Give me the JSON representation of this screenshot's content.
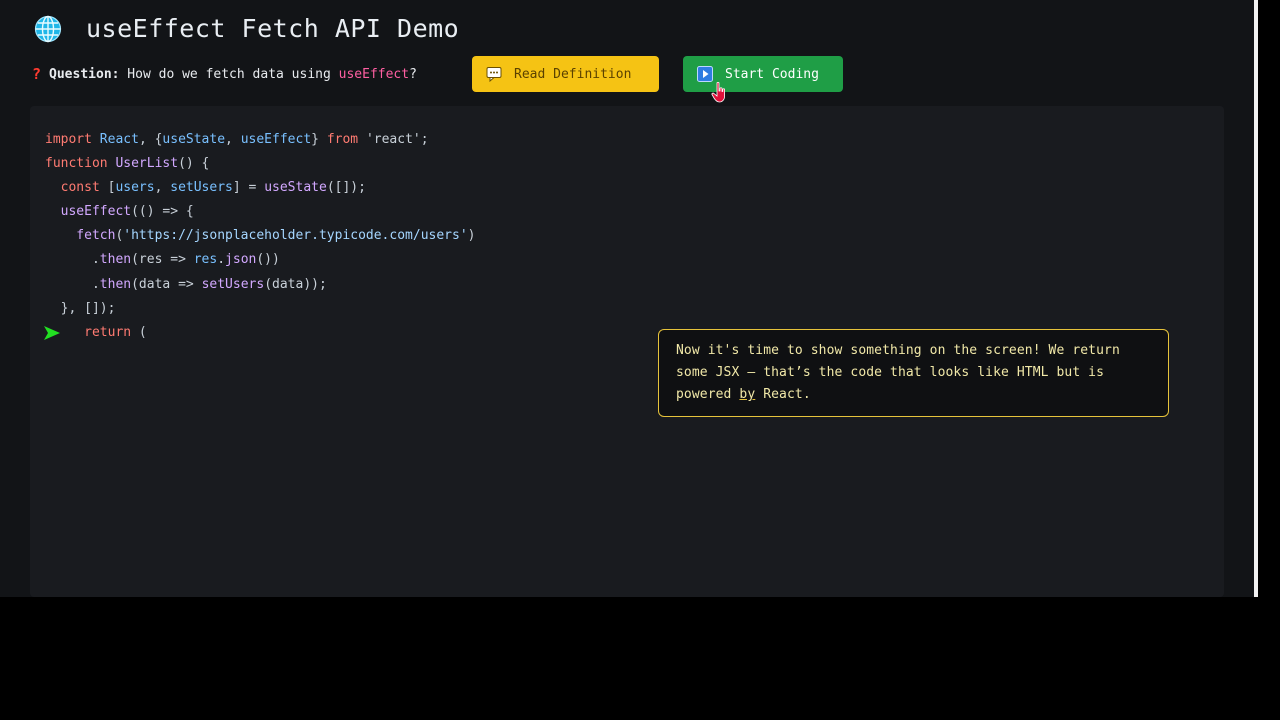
{
  "header": {
    "icon": "globe-icon",
    "title": "useEffect Fetch API Demo"
  },
  "question": {
    "mark": "?",
    "label": "Question:",
    "text_before": " How do we fetch data using ",
    "highlight": "useEffect",
    "text_after": "?"
  },
  "buttons": {
    "definition": {
      "icon": "speech-bubble-icon",
      "label": "Read Definition"
    },
    "coding": {
      "icon": "play-icon",
      "label": "Start Coding"
    }
  },
  "code_lines": [
    [
      {
        "t": "import ",
        "c": "kw"
      },
      {
        "t": "React",
        "c": "id"
      },
      {
        "t": ", {",
        "c": "pl"
      },
      {
        "t": "useState",
        "c": "id"
      },
      {
        "t": ", ",
        "c": "pl"
      },
      {
        "t": "useEffect",
        "c": "id"
      },
      {
        "t": "} ",
        "c": "pl"
      },
      {
        "t": "from ",
        "c": "kw"
      },
      {
        "t": "'react'",
        "c": "pl"
      },
      {
        "t": ";",
        "c": "pl"
      }
    ],
    [
      {
        "t": "function ",
        "c": "kw"
      },
      {
        "t": "UserList",
        "c": "fn"
      },
      {
        "t": "() {",
        "c": "pl"
      }
    ],
    [
      {
        "t": "  const ",
        "c": "kw"
      },
      {
        "t": "[",
        "c": "pl"
      },
      {
        "t": "users",
        "c": "id"
      },
      {
        "t": ", ",
        "c": "pl"
      },
      {
        "t": "setUsers",
        "c": "id"
      },
      {
        "t": "] = ",
        "c": "pl"
      },
      {
        "t": "useState",
        "c": "fn"
      },
      {
        "t": "([]);",
        "c": "pl"
      }
    ],
    [
      {
        "t": "  useEffect",
        "c": "fn"
      },
      {
        "t": "(() => {",
        "c": "pl"
      }
    ],
    [
      {
        "t": "    fetch",
        "c": "fn"
      },
      {
        "t": "(",
        "c": "pl"
      },
      {
        "t": "'https://jsonplaceholder.typicode.com/users'",
        "c": "str"
      },
      {
        "t": ")",
        "c": "pl"
      }
    ],
    [
      {
        "t": "      .",
        "c": "pl"
      },
      {
        "t": "then",
        "c": "fn"
      },
      {
        "t": "(res => ",
        "c": "pl"
      },
      {
        "t": "res",
        "c": "id"
      },
      {
        "t": ".",
        "c": "pl"
      },
      {
        "t": "json",
        "c": "fn"
      },
      {
        "t": "())",
        "c": "pl"
      }
    ],
    [
      {
        "t": "      .",
        "c": "pl"
      },
      {
        "t": "then",
        "c": "fn"
      },
      {
        "t": "(data => ",
        "c": "pl"
      },
      {
        "t": "setUsers",
        "c": "fn"
      },
      {
        "t": "(data));",
        "c": "pl"
      }
    ],
    [
      {
        "t": "  }, []);",
        "c": "pl"
      }
    ],
    [
      {
        "t": "     return ",
        "c": "kw"
      },
      {
        "t": "(",
        "c": "pl"
      }
    ]
  ],
  "pointer_icon": "play-arrow-icon",
  "tooltip": {
    "part1": "Now it's time to show something on the screen! We return some JSX — that’s the code that looks like HTML but is powered ",
    "underlined": "by",
    "part2": " React."
  },
  "colors": {
    "definition_button": "#f5c314",
    "coding_button": "#1f9e46",
    "tooltip_border": "#e6c33b",
    "pointer_arrow": "#22e022"
  }
}
